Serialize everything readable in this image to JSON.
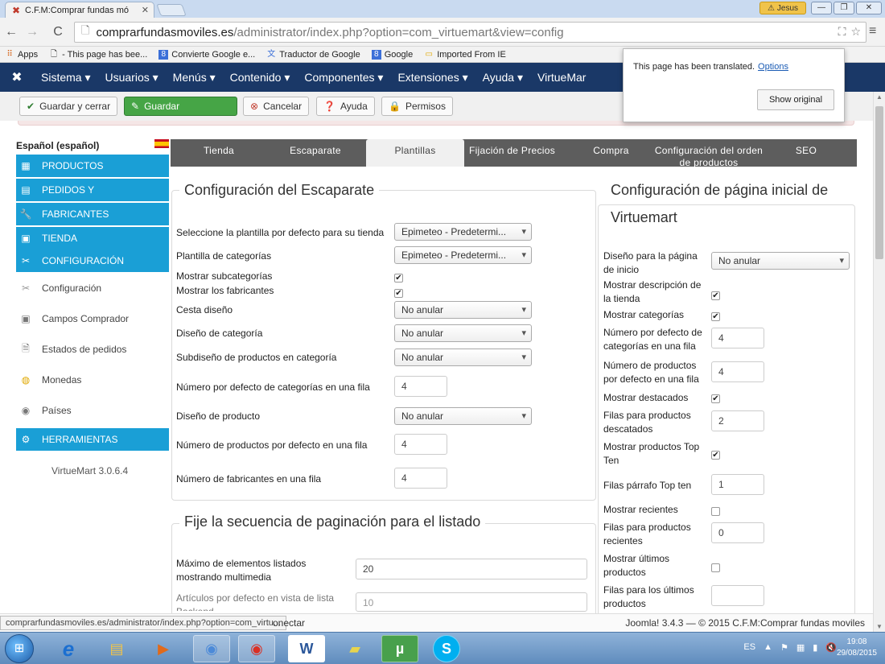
{
  "browser": {
    "tab_title": "C.F.M:Comprar fundas mó",
    "user_badge": "Jesus",
    "url_host": "comprarfundasmoviles.es",
    "url_path": "/administrator/index.php?option=com_virtuemart&view=config",
    "bookmarks": [
      "Apps",
      "- This page has bee...",
      "Convierte Google e...",
      "Traductor de Google",
      "Google",
      "Imported From IE"
    ]
  },
  "translate_popup": {
    "message": "This page has been translated.",
    "options_link": "Options",
    "show_original": "Show original"
  },
  "joomla_menu": [
    "Sistema ▾",
    "Usuarios ▾",
    "Menús ▾",
    "Contenido ▾",
    "Componentes ▾",
    "Extensiones ▾",
    "Ayuda ▾",
    "VirtueMar"
  ],
  "toolbar": {
    "save_close": "Guardar y cerrar",
    "save": "Guardar",
    "cancel": "Cancelar",
    "help": "Ayuda",
    "permissions": "Permisos"
  },
  "sidebar": {
    "language": "Español (español)",
    "items": [
      "PRODUCTOS",
      "PEDIDOS Y",
      "FABRICANTES",
      "TIENDA",
      "CONFIGURACIÓN",
      "Configuración",
      "Campos Comprador",
      "Estados de pedidos",
      "Monedas",
      "Países",
      "HERRAMIENTAS"
    ],
    "version": "VirtueMart 3.0.6.4"
  },
  "tabs": [
    "Tienda",
    "Escaparate",
    "Plantillas",
    "Fijación de Precios",
    "Compra",
    "Configuración del orden de productos",
    "SEO"
  ],
  "escaparate": {
    "legend": "Configuración del Escaparate",
    "labels": [
      "Seleccione la plantilla por defecto para su tienda",
      "Plantilla de categorías",
      "Mostrar subcategorías",
      "Mostrar los fabricantes",
      "Cesta diseño",
      "Diseño de categoría",
      "Subdiseño de productos en categoría",
      "Número por defecto de categorías en una fila",
      "Diseño de producto",
      "Número de productos por defecto en una fila",
      "Número de fabricantes en una fila"
    ],
    "template_value": "Epimeteo - Predetermi...",
    "no_override": "No anular",
    "cats_per_row": "4",
    "products_per_row": "4",
    "manufacturers_per_row": "4"
  },
  "paginacion": {
    "legend": "Fije la secuencia de paginación para el listado",
    "labels": [
      "Máximo de elementos listados mostrando multimedia",
      "Artículos por defecto en vista de lista Backend"
    ],
    "max_items": "20",
    "default_items": "10"
  },
  "pagina_inicial": {
    "legend_line1": "Configuración de página inicial de",
    "legend_line2": "Virtuemart",
    "labels": [
      "Diseño para la página de inicio",
      "Mostrar descripción de la tienda",
      "Mostrar categorías",
      "Número por defecto de categorías en una fila",
      "Número de productos por defecto en una fila",
      "Mostrar destacados",
      "Filas para productos descatados",
      "Mostrar productos Top Ten",
      "Filas párrafo Top ten",
      "Mostrar recientes",
      "Filas para productos recientes",
      "Mostrar últimos productos",
      "Filas para los últimos productos"
    ],
    "layout_value": "No anular",
    "cats_per_row": "4",
    "products_per_row": "4",
    "featured_rows": "2",
    "topten_rows": "1",
    "recent_rows": "0",
    "latest_rows": ""
  },
  "statusbar": {
    "url": "comprarfundasmoviles.es/administrator/index.php?option=com_virtu...",
    "conectar": "onectar",
    "footer": "Joomla! 3.4.3 — © 2015 C.F.M:Comprar fundas moviles"
  },
  "taskbar": {
    "lang": "ES",
    "time": "19:08",
    "date": "29/08/2015"
  },
  "colors": {
    "joomla_nav": "#1a3867",
    "sidebar_active": "#1a9fd6",
    "save_green": "#46a546",
    "tabs_bg": "#5d5d5d"
  }
}
